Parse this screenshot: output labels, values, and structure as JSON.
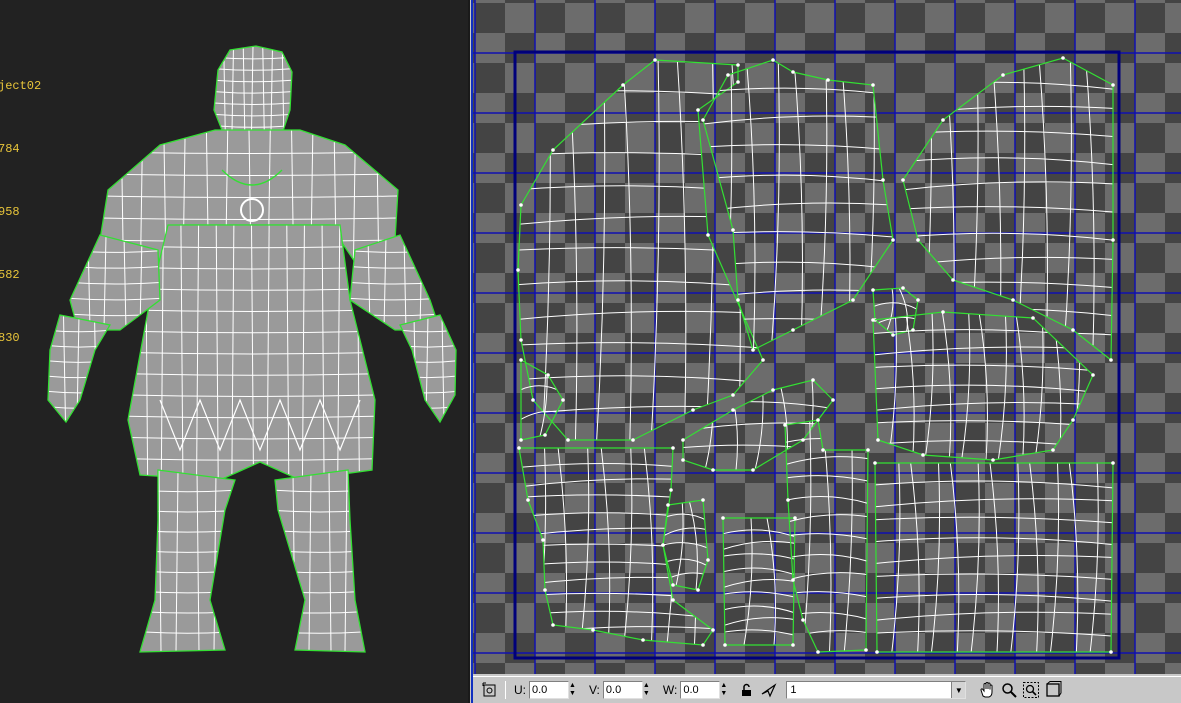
{
  "viewport": {
    "stats": [
      "ject02",
      "784",
      "958",
      "582",
      "830"
    ]
  },
  "colors": {
    "viewport_bg": "#222222",
    "stats_text": "#e8c53a",
    "mesh_fill": "#9a9a9a",
    "mesh_edge": "#ffffff",
    "seam_edge": "#33e033",
    "checker_dark": "#444444",
    "checker_light": "#6c6c6c",
    "uv_grid": "#1010b0"
  },
  "toolbar": {
    "u_label": "U:",
    "u_value": "0.0",
    "v_label": "V:",
    "v_value": "0.0",
    "w_label": "W:",
    "w_value": "0.0",
    "map_channel": "1",
    "icons": [
      "freeform-mode-icon",
      "lock-icon",
      "paint-select-icon",
      "pan-hand-icon",
      "zoom-icon",
      "zoom-region-icon",
      "zoom-extents-icon"
    ]
  }
}
